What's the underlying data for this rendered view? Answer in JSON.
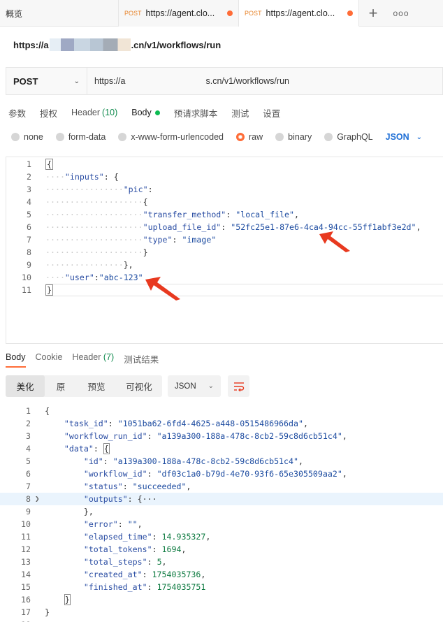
{
  "tabs": {
    "overview_label": "概览",
    "items": [
      {
        "method": "POST",
        "url": "https://agent.clo...",
        "active": false
      },
      {
        "method": "POST",
        "url": "https://agent.clo...",
        "active": true
      }
    ],
    "plus_label": "+",
    "more_label": "ooo"
  },
  "request": {
    "title_prefix": "https://a",
    "title_suffix": ".cn/v1/workflows/run",
    "method": "POST",
    "url_prefix": "https://a",
    "url_suffix": "s.cn/v1/workflows/run"
  },
  "request_tabs": [
    {
      "label": "参数"
    },
    {
      "label": "授权"
    },
    {
      "label": "Header",
      "count": "(10)"
    },
    {
      "label": "Body"
    },
    {
      "label": "预请求脚本"
    },
    {
      "label": "测试"
    },
    {
      "label": "设置"
    }
  ],
  "body_types": [
    "none",
    "form-data",
    "x-www-form-urlencoded",
    "raw",
    "binary",
    "GraphQL"
  ],
  "body_type_selected": "raw",
  "body_format": "JSON",
  "request_body": {
    "inputs_key": "\"inputs\"",
    "pic_key": "\"pic\"",
    "transfer_method_key": "\"transfer_method\"",
    "transfer_method_val": "\"local_file\"",
    "upload_file_id_key": "\"upload_file_id\"",
    "upload_file_id_val": "\"52fc25e1-87e6-4ca4-94cc-55ff1abf3e2d\"",
    "type_key": "\"type\"",
    "type_val": "\"image\"",
    "user_key": "\"user\"",
    "user_val": "\"abc-123\""
  },
  "response_tabs": [
    {
      "label": "Body"
    },
    {
      "label": "Cookie"
    },
    {
      "label": "Header",
      "count": "(7)"
    },
    {
      "label": "测试结果"
    }
  ],
  "response_view_modes": [
    "美化",
    "原",
    "预览",
    "可视化"
  ],
  "response_format": "JSON",
  "response_body": {
    "task_id_key": "\"task_id\"",
    "task_id_val": "\"1051ba62-6fd4-4625-a448-0515486966da\"",
    "workflow_run_id_key": "\"workflow_run_id\"",
    "workflow_run_id_val": "\"a139a300-188a-478c-8cb2-59c8d6cb51c4\"",
    "data_key": "\"data\"",
    "id_key": "\"id\"",
    "id_val": "\"a139a300-188a-478c-8cb2-59c8d6cb51c4\"",
    "workflow_id_key": "\"workflow_id\"",
    "workflow_id_val": "\"df03c1a0-b79d-4e70-93f6-65e305509aa2\"",
    "status_key": "\"status\"",
    "status_val": "\"succeeded\"",
    "outputs_key": "\"outputs\"",
    "outputs_collapsed": "{···",
    "error_key": "\"error\"",
    "error_val": "\"\"",
    "elapsed_time_key": "\"elapsed_time\"",
    "elapsed_time_val": "14.935327",
    "total_tokens_key": "\"total_tokens\"",
    "total_tokens_val": "1694",
    "total_steps_key": "\"total_steps\"",
    "total_steps_val": "5",
    "created_at_key": "\"created_at\"",
    "created_at_val": "1754035736",
    "finished_at_key": "\"finished_at\"",
    "finished_at_val": "1754035751"
  },
  "colors": {
    "accent": "#ff6c37",
    "link_blue": "#1f6fd6",
    "success_green": "#0cbb52"
  }
}
